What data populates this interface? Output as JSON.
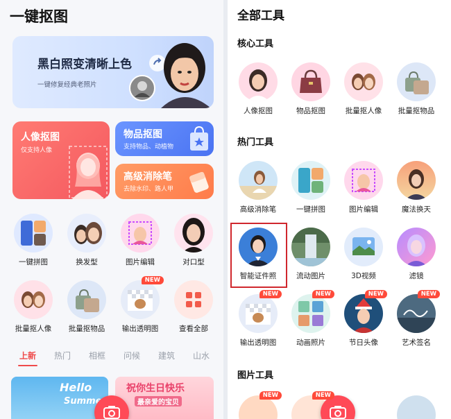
{
  "left": {
    "title": "一键抠图",
    "banner": {
      "title": "黑白照变清晰上色",
      "subtitle": "一键修复经典老照片"
    },
    "card_person": {
      "title": "人像抠图",
      "subtitle": "仅支持人像"
    },
    "card_item": {
      "title": "物品抠图",
      "subtitle": "支持物品、动植物"
    },
    "card_eraser": {
      "title": "高级消除笔",
      "subtitle": "去除水印、路人甲"
    },
    "tools_row1": [
      "一键拼图",
      "换发型",
      "图片编辑",
      "对口型"
    ],
    "tools_row2": [
      "批量抠人像",
      "批量抠物品",
      "输出透明图",
      "查看全部"
    ],
    "new_badge": "NEW",
    "tabs": [
      "上新",
      "热门",
      "相框",
      "问候",
      "建筑",
      "山水"
    ],
    "promo": {
      "hello": "Hello",
      "summer": "Summer",
      "birthday": "祝你生日快乐",
      "dear": "最亲爱的宝贝"
    }
  },
  "right": {
    "title": "全部工具",
    "sections": {
      "core": "核心工具",
      "hot": "热门工具",
      "image": "图片工具"
    },
    "core_tools": [
      "人像抠图",
      "物品抠图",
      "批量抠人像",
      "批量抠物品"
    ],
    "hot_row1": [
      "高级消除笔",
      "一键拼图",
      "图片编辑",
      "魔法换天"
    ],
    "hot_row2": [
      "智能证件照",
      "流动图片",
      "3D视频",
      "滤镜"
    ],
    "hot_row3": [
      "输出透明图",
      "动画照片",
      "节日头像",
      "艺术签名"
    ],
    "new_badge": "NEW"
  },
  "colors": {
    "accent": "#ef4a4a",
    "person_card": "#f66a6a",
    "item_card": "#4f7dfa",
    "eraser_card": "#ff8a55",
    "highlight": "#d0272d"
  }
}
